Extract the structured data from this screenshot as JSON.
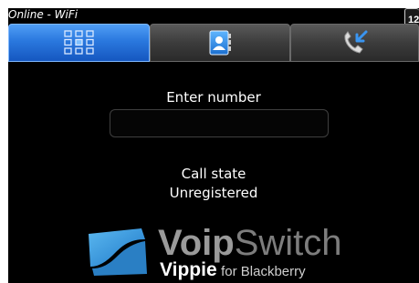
{
  "status_bar": {
    "connection": "Online - WiFi",
    "clock": "12"
  },
  "tabs": [
    {
      "id": "dial",
      "icon": "keypad-icon",
      "selected": true
    },
    {
      "id": "contacts",
      "icon": "contacts-book-icon",
      "selected": false
    },
    {
      "id": "calls",
      "icon": "call-log-icon",
      "selected": false
    }
  ],
  "dialer": {
    "label": "Enter number",
    "value": "",
    "placeholder": ""
  },
  "call_state": {
    "label": "Call state",
    "value": "Unregistered"
  },
  "logo": {
    "title_bold": "Voip",
    "title_light": "Switch",
    "product": "Vippie",
    "platform": "for Blackberry"
  },
  "colors": {
    "accent_blue": "#2a78de",
    "logo_blue": "#2b8fd6",
    "tab_gray": "#3c3c3c"
  }
}
